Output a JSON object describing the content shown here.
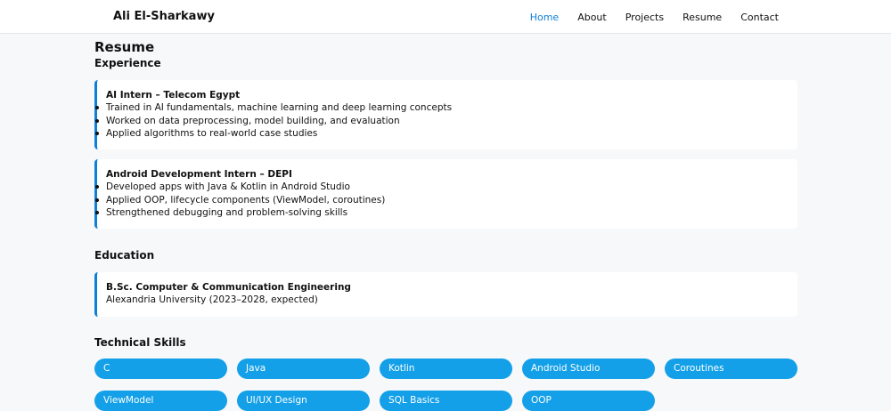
{
  "brand": "Ali El-Sharkawy",
  "nav": {
    "home": "Home",
    "about": "About",
    "projects": "Projects",
    "resume": "Resume",
    "contact": "Contact",
    "active_color": "#0f7fd6"
  },
  "resume": {
    "title": "Resume",
    "experience": {
      "heading": "Experience",
      "items": [
        {
          "title": "AI Intern – Telecom Egypt",
          "bullets": [
            "Trained in AI fundamentals, machine learning and deep learning concepts",
            "Worked on data preprocessing, model building, and evaluation",
            "Applied algorithms to real-world case studies"
          ]
        },
        {
          "title": "Android Development Intern – DEPI",
          "bullets": [
            "Developed apps with Java & Kotlin in Android Studio",
            "Applied OOP, lifecycle components (ViewModel, coroutines)",
            "Strengthened debugging and problem-solving skills"
          ]
        }
      ]
    },
    "education": {
      "heading": "Education",
      "degree": "B.Sc. Computer & Communication Engineering",
      "school": "Alexandria University (2023–2028, expected)"
    },
    "skills": {
      "heading": "Technical Skills",
      "items": [
        "C",
        "Java",
        "Kotlin",
        "Android Studio",
        "Coroutines",
        "ViewModel",
        "UI/UX Design",
        "SQL Basics",
        "OOP"
      ],
      "pill_color": "#13a0e8"
    }
  }
}
